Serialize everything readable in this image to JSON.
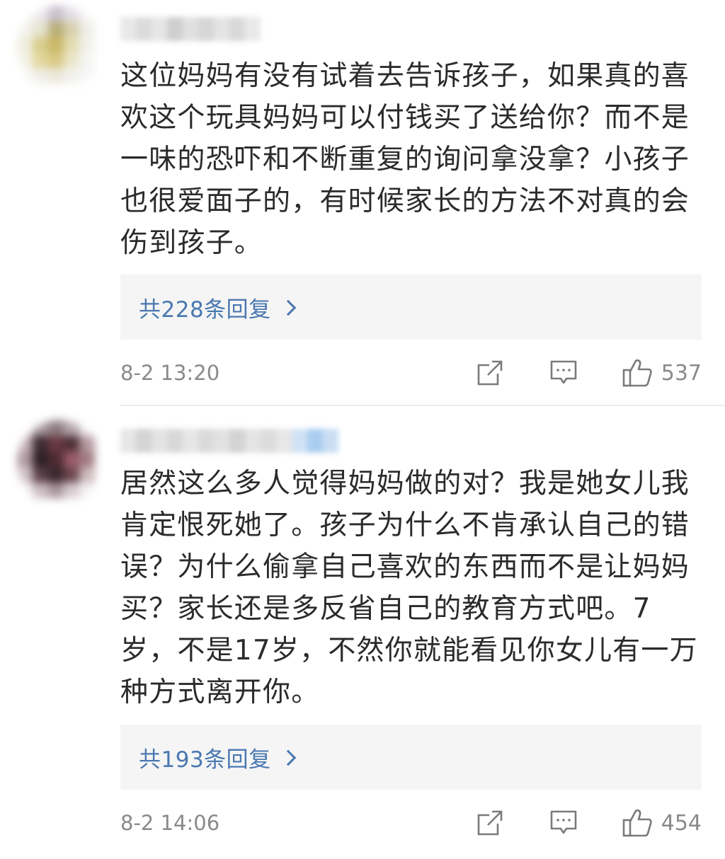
{
  "comments": [
    {
      "text": "这位妈妈有没有试着去告诉孩子，如果真的喜欢这个玩具妈妈可以付钱买了送给你？而不是一味的恐吓和不断重复的询问拿没拿？小孩子也很爱面子的，有时候家长的方法不对真的会伤到孩子。",
      "replies_label": "共228条回复",
      "time": "8-2 13:20",
      "likes": "537",
      "icons": {
        "share": "share-icon",
        "comment": "comment-icon",
        "like": "thumbs-up-icon",
        "replies": "chevron-right-icon"
      }
    },
    {
      "text": "居然这么多人觉得妈妈做的对？我是她女儿我肯定恨死她了。孩子为什么不肯承认自己的错误？为什么偷拿自己喜欢的东西而不是让妈妈买？家长还是多反省自己的教育方式吧。7岁，不是17岁，不然你就能看见你女儿有一万种方式离开你。",
      "replies_label": "共193条回复",
      "time": "8-2 14:06",
      "likes": "454",
      "icons": {
        "share": "share-icon",
        "comment": "comment-icon",
        "like": "thumbs-up-icon",
        "replies": "chevron-right-icon"
      }
    }
  ],
  "colors": {
    "link": "#4a78b0",
    "muted": "#8a8a8a",
    "reply_bg": "#f5f5f5"
  }
}
